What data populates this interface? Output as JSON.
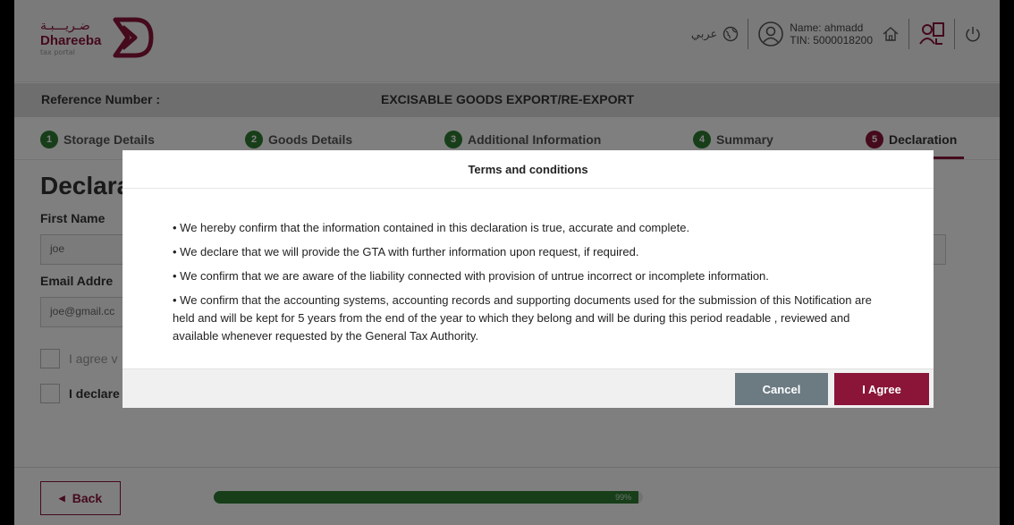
{
  "header": {
    "logo_ar": "ضـريـــبـة",
    "logo_en": "Dhareeba",
    "logo_sub": "tax portal",
    "lang_label": "عربي",
    "user_name": "Name: ahmadd",
    "user_tin": "TIN: 5000018200"
  },
  "titlebar": {
    "reference_label": "Reference Number :",
    "form_title": "EXCISABLE GOODS EXPORT/RE-EXPORT"
  },
  "steps": [
    {
      "num": "1",
      "label": "Storage Details"
    },
    {
      "num": "2",
      "label": "Goods Details"
    },
    {
      "num": "3",
      "label": "Additional Information"
    },
    {
      "num": "4",
      "label": "Summary"
    },
    {
      "num": "5",
      "label": "Declaration"
    }
  ],
  "form": {
    "heading": "Declara",
    "first_name_label": "First Name",
    "first_name_value": "joe",
    "email_label": "Email Addre",
    "email_value": "joe@gmail.cc",
    "agree_text": "I agree v",
    "declare_text": "I declare"
  },
  "footer": {
    "back_label": "Back",
    "progress_text": "99%",
    "progress_value": 0.99
  },
  "modal": {
    "title": "Terms and conditions",
    "items": [
      "• We hereby confirm that the information contained in this declaration is true, accurate and complete.",
      "• We declare that we will provide the GTA with further information upon request, if required.",
      "• We confirm that we are aware of the liability connected with provision of untrue incorrect or incomplete information.",
      "• We confirm that the accounting systems, accounting records and supporting documents used for the submission of this Notification are held and will be kept for 5 years from the end of the year to which they belong and will be during this period readable , reviewed and available whenever requested by the General Tax Authority."
    ],
    "cancel_label": "Cancel",
    "agree_label": "I Agree"
  },
  "colors": {
    "brand": "#8a1538",
    "step_done": "#2f7d32",
    "cancel": "#6c7a82"
  }
}
